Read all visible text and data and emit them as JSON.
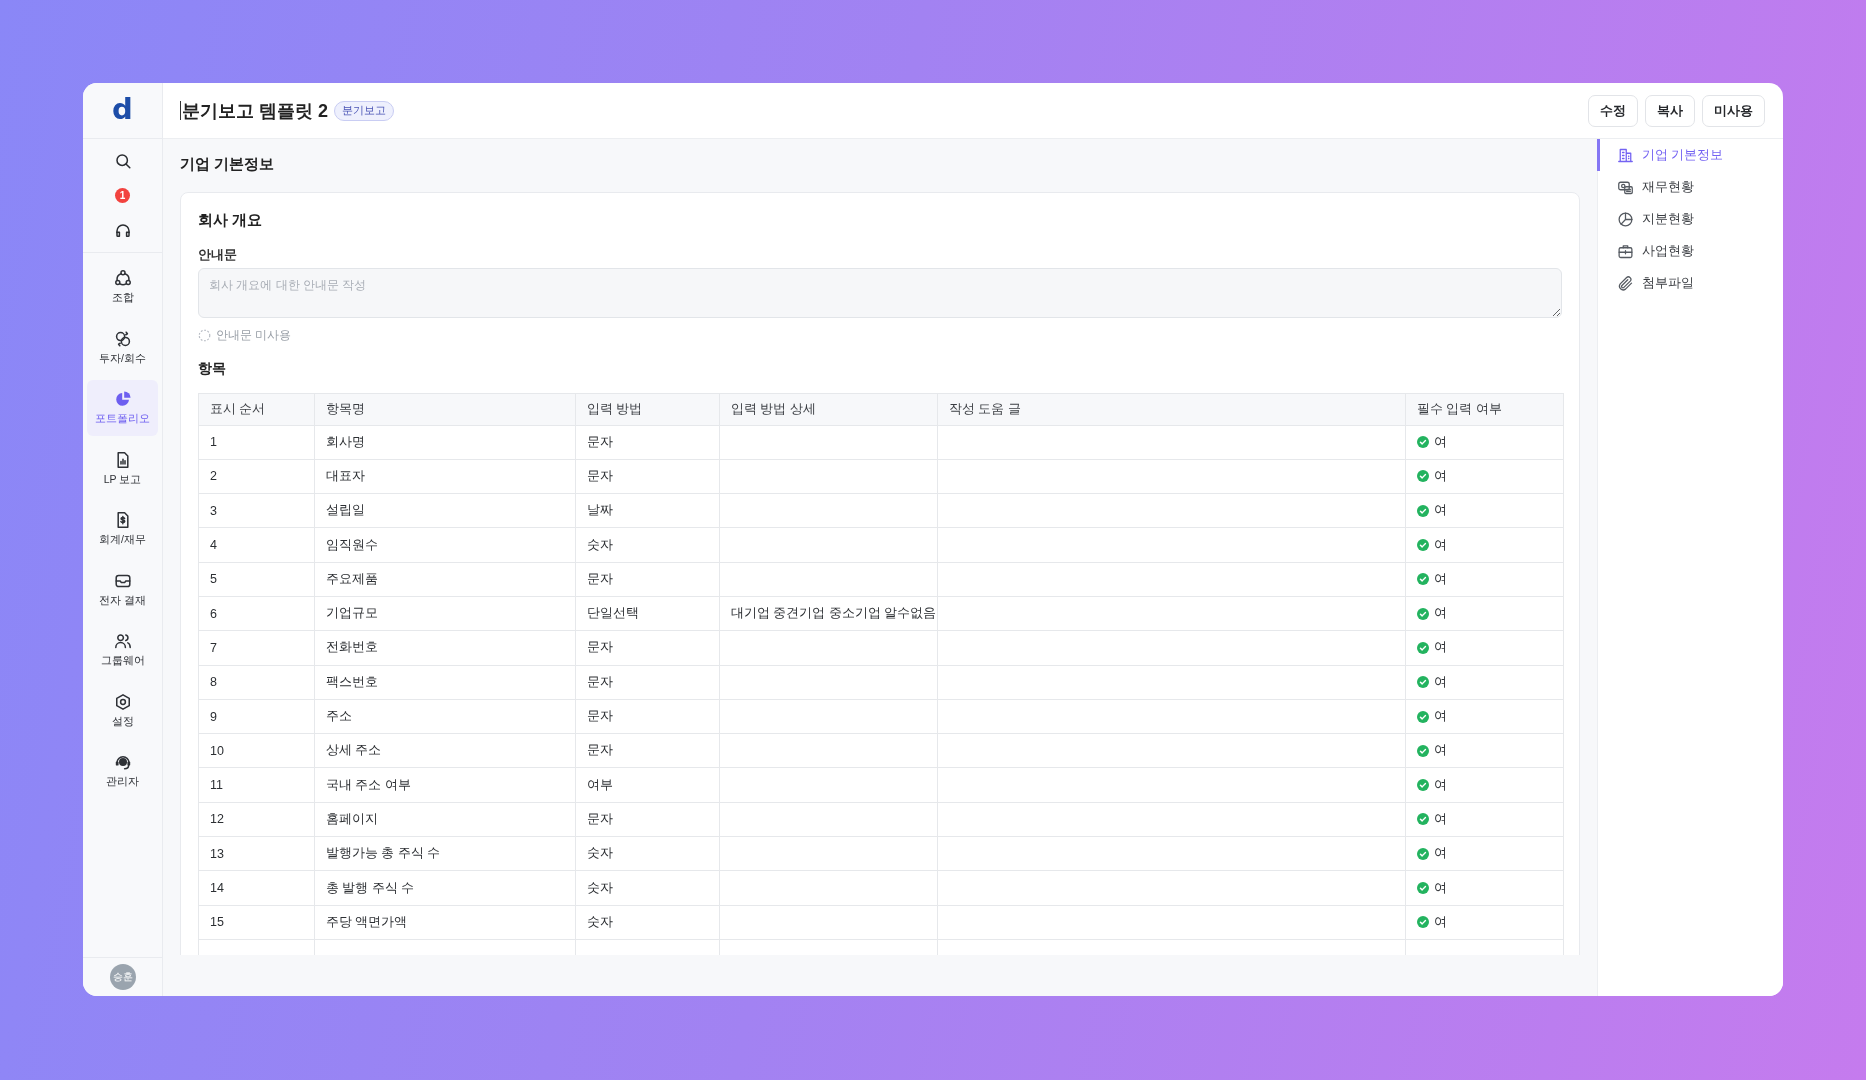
{
  "sidebar": {
    "logo": "d",
    "notification_count": "1",
    "items": [
      {
        "label": "조합",
        "selected": false
      },
      {
        "label": "투자/회수",
        "selected": false
      },
      {
        "label": "포트폴리오",
        "selected": true
      },
      {
        "label": "LP 보고",
        "selected": false
      },
      {
        "label": "회계/재무",
        "selected": false
      },
      {
        "label": "전자 결재",
        "selected": false
      },
      {
        "label": "그룹웨어",
        "selected": false
      },
      {
        "label": "설정",
        "selected": false
      },
      {
        "label": "관리자",
        "selected": false
      }
    ],
    "avatar": "승훈"
  },
  "header": {
    "title": "분기보고 템플릿 2",
    "badge": "분기보고",
    "buttons": [
      "수정",
      "복사",
      "미사용"
    ]
  },
  "page": {
    "title": "기업 기본정보"
  },
  "card": {
    "title": "회사 개요",
    "notice": {
      "label": "안내문",
      "placeholder": "회사 개요에 대한 안내문 작성"
    },
    "notice_toggle": {
      "label": "안내문 미사용",
      "checked": false
    },
    "items_title": "항목",
    "table": {
      "columns": [
        "표시 순서",
        "항목명",
        "입력 방법",
        "입력 방법 상세",
        "작성 도움 글",
        "필수 입력 여부"
      ],
      "rows": [
        {
          "order": "1",
          "name": "회사명",
          "input_method": "문자",
          "required": true,
          "required_label": "여"
        },
        {
          "order": "2",
          "name": "대표자",
          "input_method": "문자",
          "required": true,
          "required_label": "여"
        },
        {
          "order": "3",
          "name": "설립일",
          "input_method": "날짜",
          "required": true,
          "required_label": "여"
        },
        {
          "order": "4",
          "name": "임직원수",
          "input_method": "숫자",
          "required": true,
          "required_label": "여"
        },
        {
          "order": "5",
          "name": "주요제품",
          "input_method": "문자",
          "required": true,
          "required_label": "여"
        },
        {
          "order": "6",
          "name": "기업규모",
          "input_method": "단일선택",
          "method_detail": "대기업 중견기업 중소기업 알수없음",
          "required": true,
          "required_label": "여"
        },
        {
          "order": "7",
          "name": "전화번호",
          "input_method": "문자",
          "required": true,
          "required_label": "여"
        },
        {
          "order": "8",
          "name": "팩스번호",
          "input_method": "문자",
          "required": true,
          "required_label": "여"
        },
        {
          "order": "9",
          "name": "주소",
          "input_method": "문자",
          "required": true,
          "required_label": "여"
        },
        {
          "order": "10",
          "name": "상세 주소",
          "input_method": "문자",
          "required": true,
          "required_label": "여"
        },
        {
          "order": "11",
          "name": "국내 주소 여부",
          "input_method": "여부",
          "required": true,
          "required_label": "여"
        },
        {
          "order": "12",
          "name": "홈페이지",
          "input_method": "문자",
          "required": true,
          "required_label": "여"
        },
        {
          "order": "13",
          "name": "발행가능 총 주식 수",
          "input_method": "숫자",
          "required": true,
          "required_label": "여"
        },
        {
          "order": "14",
          "name": "총 발행 주식 수",
          "input_method": "숫자",
          "required": true,
          "required_label": "여"
        },
        {
          "order": "15",
          "name": "주당 액면가액",
          "input_method": "숫자",
          "required": true,
          "required_label": "여"
        }
      ]
    }
  },
  "section_nav": {
    "items": [
      {
        "label": "기업 기본정보",
        "selected": true
      },
      {
        "label": "재무현황",
        "selected": false
      },
      {
        "label": "지분현황",
        "selected": false
      },
      {
        "label": "사업현황",
        "selected": false
      },
      {
        "label": "첨부파일",
        "selected": false
      }
    ]
  }
}
